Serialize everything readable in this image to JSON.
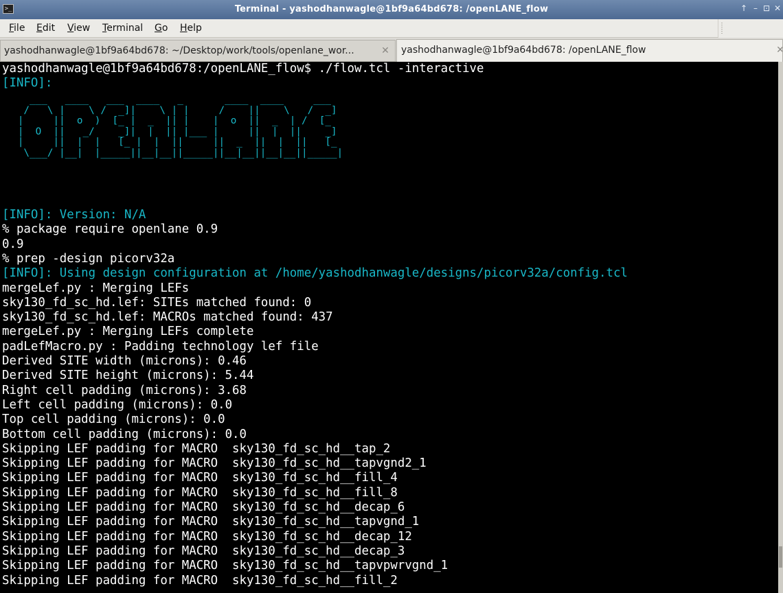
{
  "window": {
    "title": "Terminal - yashodhanwagle@1bf9a64bd678: /openLANE_flow",
    "controls": [
      "↑",
      "–",
      "⊡",
      "✕"
    ]
  },
  "menubar": [
    {
      "accel": "F",
      "rest": "ile"
    },
    {
      "accel": "E",
      "rest": "dit"
    },
    {
      "accel": "V",
      "rest": "iew"
    },
    {
      "accel": "T",
      "rest": "erminal"
    },
    {
      "accel": "G",
      "rest": "o"
    },
    {
      "accel": "H",
      "rest": "elp"
    }
  ],
  "tabs": [
    {
      "label": "yashodhanwagle@1bf9a64bd678: ~/Desktop/work/tools/openlane_wor...",
      "active": false
    },
    {
      "label": "yashodhanwagle@1bf9a64bd678: /openLANE_flow",
      "active": true
    }
  ],
  "terminal": {
    "prompt_line": "yashodhanwagle@1bf9a64bd678:/openLANE_flow$ ./flow.tcl -interactive",
    "info_header": "[INFO]:",
    "logo_art": "     ___   ____   ___  ____   _       ____  ____     ___\n    /   \\ |    \\ /  _]|    \\ | |     /    ||    \\   /  _]\n   |     ||  o  )  [_ |  _  || |    |  o  ||  _  | /  [_\n   |  O  ||   _/    _]|  |  || |___ |     ||  |  ||    _]\n   |     ||  |  |   [_ |  |  ||     ||  _  ||  |  ||   [_\n    \\___/ |__|  |_____||__|__||_____||__|__||__|__||_____|",
    "output": [
      {
        "text": "[INFO]: Version: N/A",
        "type": "info"
      },
      {
        "text": "% package require openlane 0.9",
        "type": "normal"
      },
      {
        "text": "0.9",
        "type": "normal"
      },
      {
        "text": "% prep -design picorv32a",
        "type": "normal"
      },
      {
        "text": "[INFO]: Using design configuration at /home/yashodhanwagle/designs/picorv32a/config.tcl",
        "type": "info"
      },
      {
        "text": "mergeLef.py : Merging LEFs",
        "type": "normal"
      },
      {
        "text": "sky130_fd_sc_hd.lef: SITEs matched found: 0",
        "type": "normal"
      },
      {
        "text": "sky130_fd_sc_hd.lef: MACROs matched found: 437",
        "type": "normal"
      },
      {
        "text": "mergeLef.py : Merging LEFs complete",
        "type": "normal"
      },
      {
        "text": "padLefMacro.py : Padding technology lef file",
        "type": "normal"
      },
      {
        "text": "Derived SITE width (microns): 0.46",
        "type": "normal"
      },
      {
        "text": "Derived SITE height (microns): 5.44",
        "type": "normal"
      },
      {
        "text": "Right cell padding (microns): 3.68",
        "type": "normal"
      },
      {
        "text": "Left cell padding (microns): 0.0",
        "type": "normal"
      },
      {
        "text": "Top cell padding (microns): 0.0",
        "type": "normal"
      },
      {
        "text": "Bottom cell padding (microns): 0.0",
        "type": "normal"
      },
      {
        "text": "Skipping LEF padding for MACRO  sky130_fd_sc_hd__tap_2",
        "type": "normal"
      },
      {
        "text": "Skipping LEF padding for MACRO  sky130_fd_sc_hd__tapvgnd2_1",
        "type": "normal"
      },
      {
        "text": "Skipping LEF padding for MACRO  sky130_fd_sc_hd__fill_4",
        "type": "normal"
      },
      {
        "text": "Skipping LEF padding for MACRO  sky130_fd_sc_hd__fill_8",
        "type": "normal"
      },
      {
        "text": "Skipping LEF padding for MACRO  sky130_fd_sc_hd__decap_6",
        "type": "normal"
      },
      {
        "text": "Skipping LEF padding for MACRO  sky130_fd_sc_hd__tapvgnd_1",
        "type": "normal"
      },
      {
        "text": "Skipping LEF padding for MACRO  sky130_fd_sc_hd__decap_12",
        "type": "normal"
      },
      {
        "text": "Skipping LEF padding for MACRO  sky130_fd_sc_hd__decap_3",
        "type": "normal"
      },
      {
        "text": "Skipping LEF padding for MACRO  sky130_fd_sc_hd__tapvpwrvgnd_1",
        "type": "normal"
      },
      {
        "text": "Skipping LEF padding for MACRO  sky130_fd_sc_hd__fill_2",
        "type": "normal"
      }
    ]
  },
  "scrollbar": {
    "position": 0.95,
    "visible_fraction": 0.04
  },
  "colors": {
    "info": "#19b8c8",
    "text": "#ffffff",
    "background": "#000000"
  }
}
